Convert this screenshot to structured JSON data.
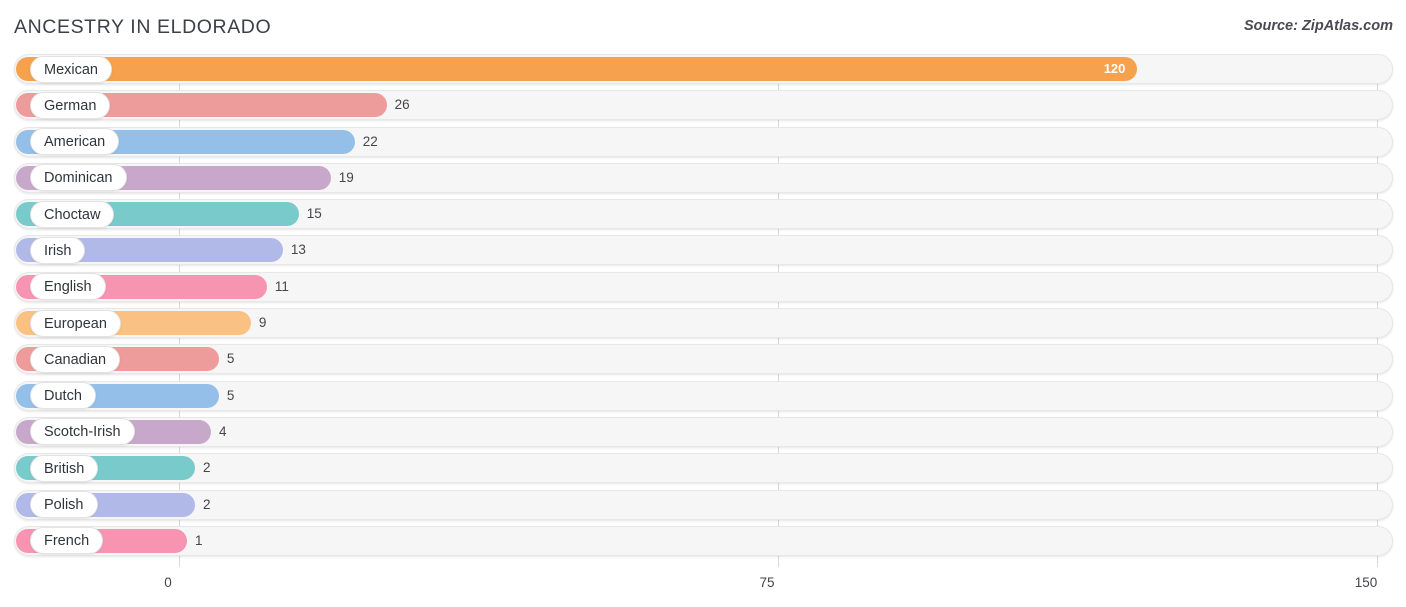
{
  "header": {
    "title": "ANCESTRY IN ELDORADO",
    "source": "Source: ZipAtlas.com"
  },
  "chart_data": {
    "type": "bar",
    "orientation": "horizontal",
    "title": "ANCESTRY IN ELDORADO",
    "xlabel": "",
    "ylabel": "",
    "xlim": [
      0,
      150
    ],
    "grid": true,
    "legend": "none",
    "ticks": [
      "0",
      "75",
      "150"
    ],
    "tick_values": [
      0,
      75,
      150
    ],
    "categories": [
      "Mexican",
      "German",
      "American",
      "Dominican",
      "Choctaw",
      "Irish",
      "English",
      "European",
      "Canadian",
      "Dutch",
      "Scotch-Irish",
      "British",
      "Polish",
      "French"
    ],
    "values": [
      120,
      26,
      22,
      19,
      15,
      13,
      11,
      9,
      5,
      5,
      4,
      2,
      2,
      1
    ],
    "bars": [
      {
        "label": "Mexican",
        "value": 120,
        "value_text": "120",
        "color": "#f5a14e",
        "label_inside": true
      },
      {
        "label": "German",
        "value": 26,
        "value_text": "26",
        "color": "#ee9b9b",
        "label_inside": false
      },
      {
        "label": "American",
        "value": 22,
        "value_text": "22",
        "color": "#93bfe8",
        "label_inside": false
      },
      {
        "label": "Dominican",
        "value": 19,
        "value_text": "19",
        "color": "#c8a8ca",
        "label_inside": false
      },
      {
        "label": "Choctaw",
        "value": 15,
        "value_text": "15",
        "color": "#79cbcb",
        "label_inside": false
      },
      {
        "label": "Irish",
        "value": 13,
        "value_text": "13",
        "color": "#b1b9e8",
        "label_inside": false
      },
      {
        "label": "English",
        "value": 11,
        "value_text": "11",
        "color": "#f794b2",
        "label_inside": false
      },
      {
        "label": "European",
        "value": 9,
        "value_text": "9",
        "color": "#fbc183",
        "label_inside": false
      },
      {
        "label": "Canadian",
        "value": 5,
        "value_text": "5",
        "color": "#ee9b9b",
        "label_inside": false
      },
      {
        "label": "Dutch",
        "value": 5,
        "value_text": "5",
        "color": "#93bfe8",
        "label_inside": false
      },
      {
        "label": "Scotch-Irish",
        "value": 4,
        "value_text": "4",
        "color": "#c8a8ca",
        "label_inside": false
      },
      {
        "label": "British",
        "value": 2,
        "value_text": "2",
        "color": "#79cbcb",
        "label_inside": false
      },
      {
        "label": "Polish",
        "value": 2,
        "value_text": "2",
        "color": "#b1b9e8",
        "label_inside": false
      },
      {
        "label": "French",
        "value": 1,
        "value_text": "1",
        "color": "#f794b2",
        "label_inside": false
      }
    ]
  }
}
